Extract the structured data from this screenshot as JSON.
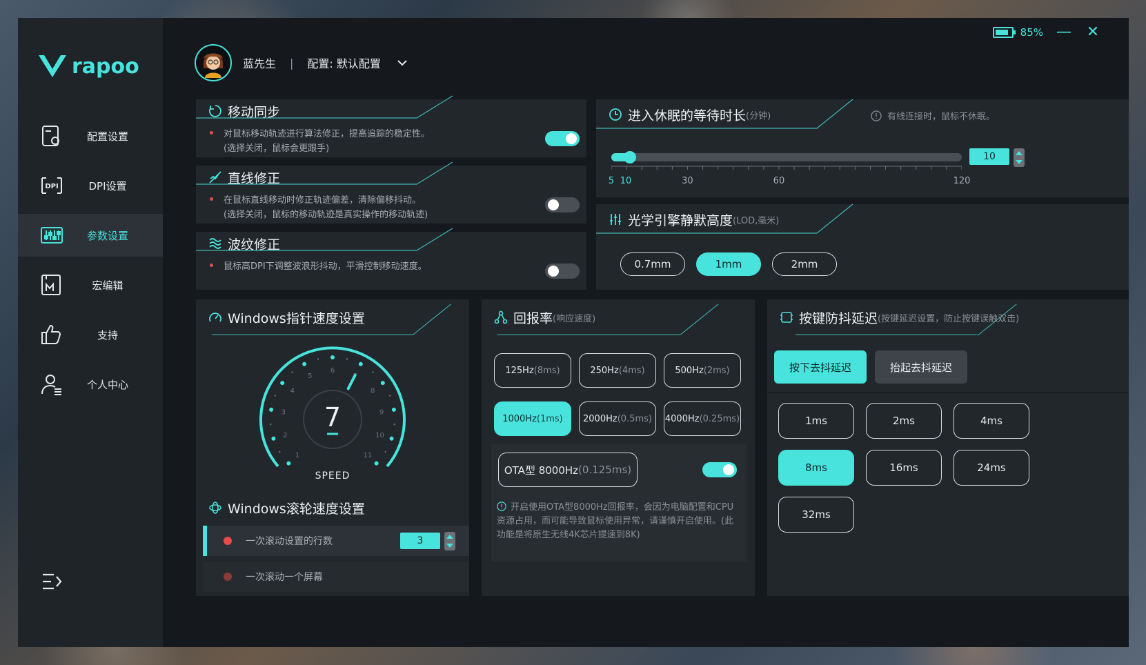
{
  "brand": {
    "logo_text": "rapoo"
  },
  "sidebar": {
    "items": [
      {
        "label": "配置设置",
        "icon": "config-icon"
      },
      {
        "label": "DPI设置",
        "icon": "dpi-icon"
      },
      {
        "label": "参数设置",
        "icon": "params-icon"
      },
      {
        "label": "宏编辑",
        "icon": "macro-icon"
      },
      {
        "label": "支持",
        "icon": "thumbs-up-icon"
      },
      {
        "label": "个人中心",
        "icon": "user-icon"
      }
    ],
    "active_index": 2
  },
  "topbar": {
    "battery": "85%",
    "battery_level": 0.85,
    "minimize": "—",
    "close": "✕"
  },
  "profile": {
    "name": "蓝先生",
    "separator": "|",
    "config": "配置: 默认配置"
  },
  "motion_sync": {
    "title": "移动同步",
    "desc1": "对鼠标移动轨迹进行算法修正，提高追踪的稳定性。",
    "desc2": "(选择关闭，鼠标会更跟手)",
    "enabled": true
  },
  "angle_snap": {
    "title": "直线修正",
    "desc1": "在鼠标直线移动时修正轨迹偏差，清除偏移抖动。",
    "desc2": "(选择关闭，鼠标的移动轨迹是真实操作的移动轨迹)",
    "enabled": false
  },
  "ripple": {
    "title": "波纹修正",
    "desc1": "鼠标高DPI下调整波浪形抖动，平滑控制移动速度。",
    "enabled": false
  },
  "sleep": {
    "title": "进入休眠的等待时长",
    "unit": "(分钟)",
    "note": "有线连接时，鼠标不休眠。",
    "value": "10",
    "min": 5,
    "max": 120,
    "current": 10,
    "tick_labels": [
      "5",
      "10",
      "30",
      "60",
      "120"
    ],
    "tick_values": [
      5,
      10,
      30,
      60,
      120
    ]
  },
  "lod": {
    "title": "光学引擎静默高度",
    "unit": "(LOD,毫米)",
    "options": [
      "0.7mm",
      "1mm",
      "2mm"
    ],
    "selected": 1
  },
  "pointer_speed": {
    "title": "Windows指针速度设置",
    "value": "7",
    "caption": "SPEED",
    "dial_labels": [
      "1",
      "2",
      "3",
      "4",
      "5",
      "6",
      "7",
      "8",
      "9",
      "10",
      "11"
    ]
  },
  "wheel_speed": {
    "title": "Windows滚轮速度设置",
    "row1_label": "一次滚动设置的行数",
    "row1_value": "3",
    "row2_label": "一次滚动一个屏幕"
  },
  "polling": {
    "title": "回报率",
    "unit": "(响应速度)",
    "options": [
      {
        "hz": "125Hz",
        "ms": "(8ms)"
      },
      {
        "hz": "250Hz",
        "ms": "(4ms)"
      },
      {
        "hz": "500Hz",
        "ms": "(2ms)"
      },
      {
        "hz": "1000Hz",
        "ms": "(1ms)"
      },
      {
        "hz": "2000Hz",
        "ms": "(0.5ms)"
      },
      {
        "hz": "4000Hz",
        "ms": "(0.25ms)"
      }
    ],
    "selected": 3,
    "ota_hz": "OTA型 8000Hz",
    "ota_ms": "(0.125ms)",
    "ota_enabled": true,
    "ota_note": "开启使用OTA型8000Hz回报率，会因为电脑配置和CPU资源占用，而可能导致鼠标使用异常，请谨慎开启使用。(此功能是将原生无线4K芯片提速到8K)"
  },
  "debounce": {
    "title": "按键防抖延迟",
    "unit": "(按键延迟设置，防止按键误触双击)",
    "tab_press": "按下去抖延迟",
    "tab_release": "抬起去抖延迟",
    "options": [
      "1ms",
      "2ms",
      "4ms",
      "8ms",
      "16ms",
      "24ms",
      "32ms"
    ],
    "selected": 3
  },
  "colors": {
    "accent": "#47e3dc",
    "bg": "#15191d",
    "panel": "#22272c",
    "sidebar": "#1f2429"
  }
}
